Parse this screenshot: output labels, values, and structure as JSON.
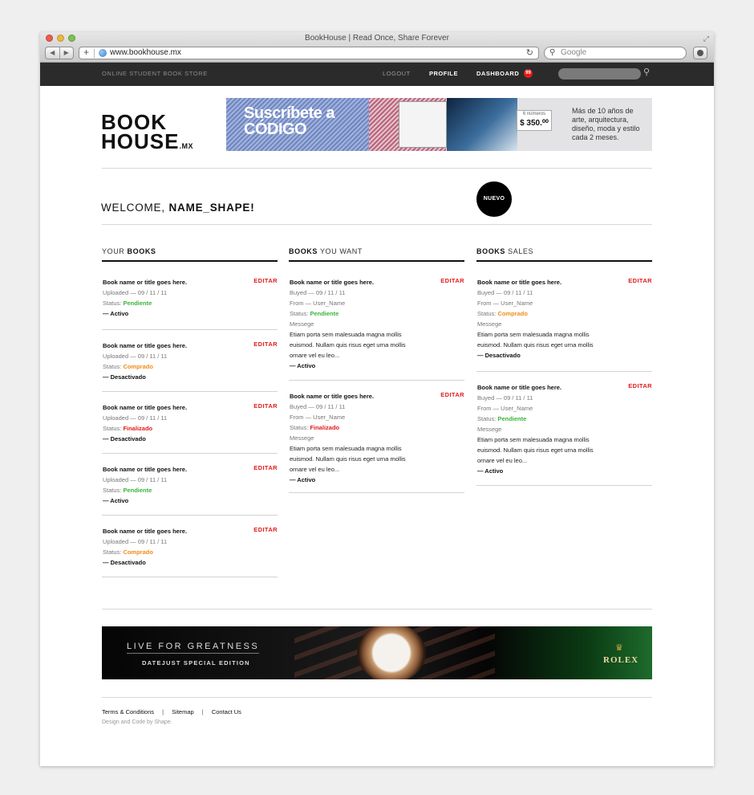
{
  "browser": {
    "window_title": "BookHouse | Read Once, Share Forever",
    "url": "www.bookhouse.mx",
    "search_placeholder": "Google"
  },
  "topbar": {
    "tagline": "ONLINE STUDENT BOOK STORE",
    "logout": "LOGOUT",
    "profile": "PROFILE",
    "dashboard": "DASHBOARD",
    "badge_count": "99"
  },
  "logo": {
    "line1": "BOOK",
    "line2": "HOUSE",
    "suffix": ".MX"
  },
  "ad_top": {
    "headline_1": "Suscríbete a",
    "headline_2": "CÓDIGO",
    "issues": "6 números",
    "price": "$ 350.⁰⁰",
    "description": "Más de 10 años de arte, arquitectura, diseño, moda y estilo cada 2 meses."
  },
  "welcome": {
    "prefix": "WELCOME, ",
    "name": "NAME_SHAPE!"
  },
  "nuevo_label": "NUEVO",
  "columns": {
    "your_books": {
      "head_prefix": "YOUR ",
      "head_bold": "BOOKS",
      "items": [
        {
          "title": "Book name or title goes here.",
          "edit": "EDITAR",
          "uploaded": "Uploaded — 09 / 11 / 11",
          "status_label": "Status: ",
          "status": "Pendiente",
          "state": "— Activo"
        },
        {
          "title": "Book name or title goes here.",
          "edit": "EDITAR",
          "uploaded": "Uploaded — 09 / 11 / 11",
          "status_label": "Status: ",
          "status": "Comprado",
          "state": "— Desactivado"
        },
        {
          "title": "Book name or title goes here.",
          "edit": "EDITAR",
          "uploaded": "Uploaded — 09 / 11 / 11",
          "status_label": "Status: ",
          "status": "Finalizado",
          "state": "— Desactivado"
        },
        {
          "title": "Book name or title goes here.",
          "edit": "EDITAR",
          "uploaded": "Uploaded — 09 / 11 / 11",
          "status_label": "Status: ",
          "status": "Pendiente",
          "state": "— Activo"
        },
        {
          "title": "Book name or title goes here.",
          "edit": "EDITAR",
          "uploaded": "Uploaded — 09 / 11 / 11",
          "status_label": "Status: ",
          "status": "Comprado",
          "state": "— Desactivado"
        }
      ]
    },
    "books_you_want": {
      "head_bold": "BOOKS",
      "head_suffix": " YOU WANT",
      "items": [
        {
          "title": "Book name or title goes here.",
          "edit": "EDITAR",
          "date": "Buyed — 09 / 11 / 11",
          "from": "From — User_Name",
          "status_label": "Status: ",
          "status": "Pendiente",
          "message_label": "Messege",
          "message_1": "Etiam porta sem malesuada magna mollis",
          "message_2": "euismod. Nullam quis risus eget urna mollis",
          "message_3": "ornare vel eu leo...",
          "state": "— Activo"
        },
        {
          "title": "Book name or title goes here.",
          "edit": "EDITAR",
          "date": "Buyed — 09 / 11 / 11",
          "from": "From — User_Name",
          "status_label": "Status: ",
          "status": "Finalizado",
          "message_label": "Messege",
          "message_1": "Etiam porta sem malesuada magna mollis",
          "message_2": "euismod. Nullam quis risus eget urna mollis",
          "message_3": "ornare vel eu leo...",
          "state": "— Activo"
        }
      ]
    },
    "books_sales": {
      "head_bold": "BOOKS",
      "head_suffix": " SALES",
      "items": [
        {
          "title": "Book name or title goes here.",
          "edit": "EDITAR",
          "date": "Buyed — 09 / 11 / 11",
          "from": "From — User_Name",
          "status_label": "Status: ",
          "status": "Comprado",
          "message_label": "Messege",
          "message_1": "Etiam porta sem malesuada magna mollis",
          "message_2": "euismod. Nullam quis risus eget urna mollis",
          "message_3": "ornare vel eu leo...",
          "state": "— Desactivado"
        },
        {
          "title": "Book name or title goes here.",
          "edit": "EDITAR",
          "date": "Buyed — 09 / 11 / 11",
          "from": "From — User_Name",
          "status_label": "Status: ",
          "status": "Pendiente",
          "message_label": "Messege",
          "message_1": "Etiam porta sem malesuada magna mollis",
          "message_2": "euismod. Nullam quis risus eget urna mollis",
          "message_3": "ornare vel eu leo...",
          "state": "— Activo"
        }
      ]
    }
  },
  "ad_bottom": {
    "line1": "LIVE FOR GREATNESS",
    "line2": "DATEJUST SPECIAL EDITION",
    "brand": "ROLEX"
  },
  "footer": {
    "terms": "Terms & Conditions",
    "sitemap": "Sitemap",
    "contact": "Contact Us",
    "separator": "|",
    "credit": "Design and Code by Shape."
  },
  "colors": {
    "accent_red": "#e11b1b",
    "status_green": "#3bb43b",
    "status_orange": "#f08c1a",
    "topbar_bg": "#2b2b2b"
  },
  "icons": [
    "back-icon",
    "forward-icon",
    "add-tab-icon",
    "globe-icon",
    "reload-icon",
    "search-icon",
    "extension-icon",
    "resize-icon"
  ]
}
